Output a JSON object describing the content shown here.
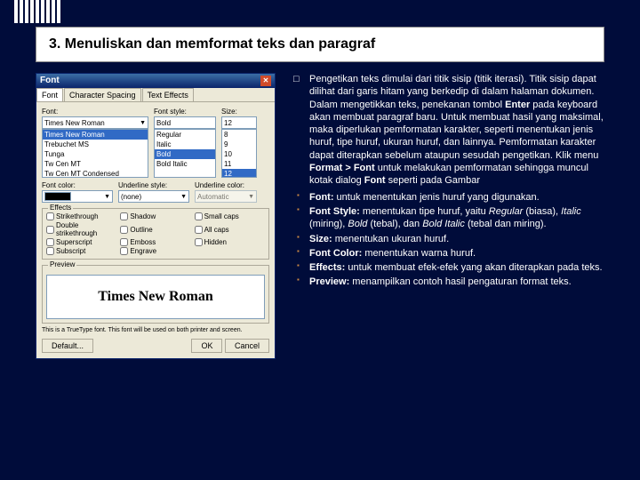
{
  "heading": "3.   Menuliskan dan memformat teks dan paragraf",
  "dialog": {
    "title": "Font",
    "tabs": [
      "Font",
      "Character Spacing",
      "Text Effects"
    ],
    "labels": {
      "font": "Font:",
      "style": "Font style:",
      "size": "Size:",
      "color": "Font color:",
      "ustyle": "Underline style:",
      "ucolor": "Underline color:",
      "effects": "Effects",
      "preview": "Preview"
    },
    "font_value": "Times New Roman",
    "font_list": [
      "Times New Roman",
      "Trebuchet MS",
      "Tunga",
      "Tw Cen MT",
      "Tw Cen MT Condensed"
    ],
    "style_value": "Bold",
    "style_list": [
      "Regular",
      "Italic",
      "Bold",
      "Bold Italic"
    ],
    "size_value": "12",
    "size_list": [
      "8",
      "9",
      "10",
      "11",
      "12"
    ],
    "ustyle_value": "(none)",
    "ucolor_value": "Automatic",
    "effects": [
      "Strikethrough",
      "Shadow",
      "Small caps",
      "Double strikethrough",
      "Outline",
      "All caps",
      "Superscript",
      "Emboss",
      "Hidden",
      "Subscript",
      "Engrave"
    ],
    "preview_text": "Times New Roman",
    "preview_note": "This is a TrueType font. This font will be used on both printer and screen.",
    "buttons": {
      "default": "Default...",
      "ok": "OK",
      "cancel": "Cancel"
    }
  },
  "para": {
    "main": "Pengetikan teks dimulai dari titik sisip (titik iterasi). Titik sisip dapat dilihat dari garis hitam yang berkedip di dalam halaman dokumen. Dalam mengetikkan teks, penekanan tombol ",
    "b1": "Enter",
    "main2": " pada keyboard akan membuat paragraf baru. Untuk membuat hasil yang maksimal, maka diperlukan pemformatan karakter, seperti menentukan jenis huruf, tipe huruf, ukuran huruf, dan lainnya. Pemformatan karakter dapat diterapkan sebelum ataupun sesudah pengetikan. Klik menu ",
    "b2": "Format > Font",
    "main3": " untuk melakukan pemformatan sehingga muncul kotak dialog ",
    "b3": "Font",
    "main4": " seperti pada Gambar"
  },
  "bullets": [
    {
      "b": "Font:",
      "t": " untuk menentukan jenis huruf yang digunakan."
    },
    {
      "b": "Font Style:",
      "t": " menentukan tipe huruf, yaitu ",
      "i": "Regular",
      "t2": " (biasa), ",
      "i2": "Italic",
      "t3": " (miring), ",
      "i3": "Bold",
      "t4": " (tebal), dan ",
      "i4": "Bold Italic",
      "t5": " (tebal dan miring)."
    },
    {
      "b": "Size:",
      "t": " menentukan ukuran huruf."
    },
    {
      "b": "Font Color:",
      "t": " menentukan warna huruf."
    },
    {
      "b": "Effects:",
      "t": " untuk membuat efek-efek yang akan diterapkan pada teks."
    },
    {
      "b": "Preview:",
      "t": " menampilkan contoh hasil pengaturan format teks."
    }
  ]
}
